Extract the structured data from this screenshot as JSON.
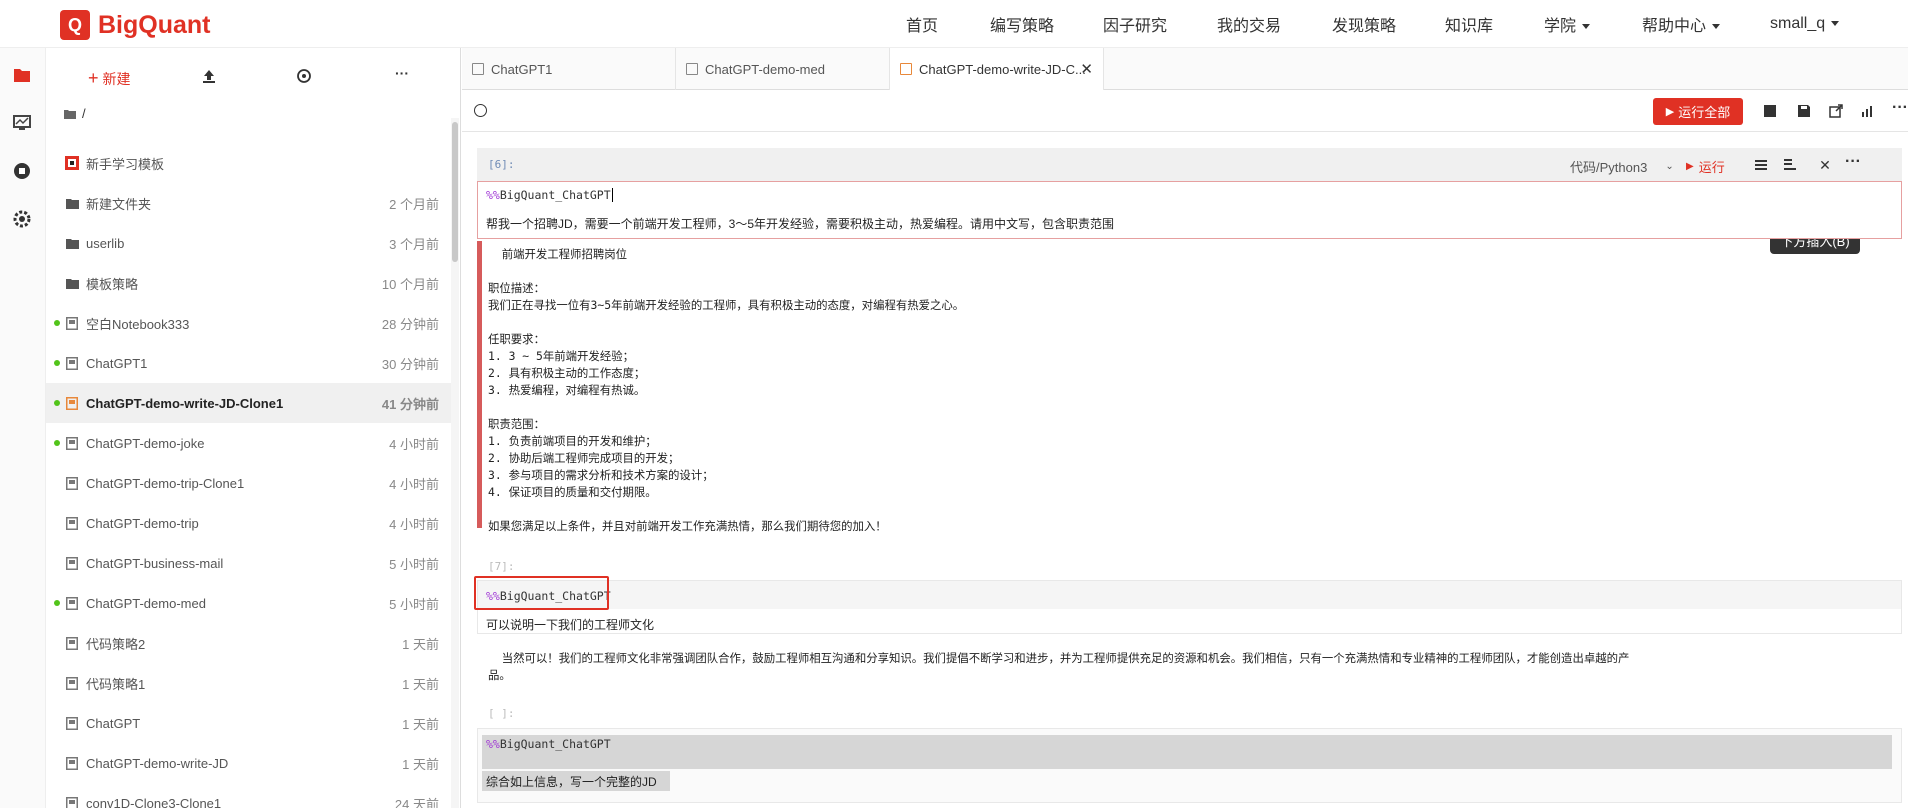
{
  "brand": {
    "name": "BigQuant",
    "mark": "Q"
  },
  "nav": {
    "items": [
      "首页",
      "编写策略",
      "因子研究",
      "我的交易",
      "发现策略",
      "知识库",
      "学院",
      "帮助中心",
      "small_q"
    ]
  },
  "leftbar": {
    "icons": [
      "folder-icon",
      "monitor-icon",
      "stop-icon",
      "settings-icon"
    ]
  },
  "sidebar": {
    "new_label": "新建",
    "path": "/",
    "items": [
      {
        "name": "新手学习模板",
        "time": "",
        "type": "template",
        "running": false
      },
      {
        "name": "新建文件夹",
        "time": "2 个月前",
        "type": "folder",
        "running": false
      },
      {
        "name": "userlib",
        "time": "3 个月前",
        "type": "folder",
        "running": false
      },
      {
        "name": "模板策略",
        "time": "10 个月前",
        "type": "folder",
        "running": false
      },
      {
        "name": "空白Notebook333",
        "time": "28 分钟前",
        "type": "notebook",
        "running": true
      },
      {
        "name": "ChatGPT1",
        "time": "30 分钟前",
        "type": "notebook",
        "running": true
      },
      {
        "name": "ChatGPT-demo-write-JD-Clone1",
        "time": "41 分钟前",
        "type": "notebook-active",
        "running": true
      },
      {
        "name": "ChatGPT-demo-joke",
        "time": "4 小时前",
        "type": "notebook",
        "running": true
      },
      {
        "name": "ChatGPT-demo-trip-Clone1",
        "time": "4 小时前",
        "type": "notebook",
        "running": false
      },
      {
        "name": "ChatGPT-demo-trip",
        "time": "4 小时前",
        "type": "notebook",
        "running": false
      },
      {
        "name": "ChatGPT-business-mail",
        "time": "5 小时前",
        "type": "notebook",
        "running": false
      },
      {
        "name": "ChatGPT-demo-med",
        "time": "5 小时前",
        "type": "notebook",
        "running": true
      },
      {
        "name": "代码策略2",
        "time": "1 天前",
        "type": "notebook",
        "running": false
      },
      {
        "name": "代码策略1",
        "time": "1 天前",
        "type": "notebook",
        "running": false
      },
      {
        "name": "ChatGPT",
        "time": "1 天前",
        "type": "notebook",
        "running": false
      },
      {
        "name": "ChatGPT-demo-write-JD",
        "time": "1 天前",
        "type": "notebook",
        "running": false
      },
      {
        "name": "conv1D-Clone3-Clone1",
        "time": "24 天前",
        "type": "notebook",
        "running": false
      }
    ]
  },
  "tabs": [
    {
      "label": "ChatGPT1",
      "active": false
    },
    {
      "label": "ChatGPT-demo-med",
      "active": false
    },
    {
      "label": "ChatGPT-demo-write-JD-C...",
      "active": true
    }
  ],
  "toolbar": {
    "run_all": "运行全部"
  },
  "cell6": {
    "prompt": "[6]:",
    "kernel": "代码/Python3",
    "run": "运行",
    "tooltip": "下方插入(B)",
    "magic": "%%",
    "magic_name": "BigQuant_ChatGPT",
    "input_text": "帮我一个招聘JD，需要一个前端开发工程师，3～5年开发经验，需要积极主动，热爱编程。请用中文写，包含职责范围",
    "output_lines": [
      "  前端开发工程师招聘岗位",
      "",
      "职位描述：",
      "我们正在寻找一位有3~5年前端开发经验的工程师，具有积极主动的态度，对编程有热爱之心。",
      "",
      "任职要求：",
      "1. 3 ~ 5年前端开发经验；",
      "2. 具有积极主动的工作态度；",
      "3. 热爱编程，对编程有热诚。",
      "",
      "职责范围：",
      "1. 负责前端项目的开发和维护；",
      "2. 协助后端工程师完成项目的开发；",
      "3. 参与项目的需求分析和技术方案的设计；",
      "4. 保证项目的质量和交付期限。",
      "",
      "如果您满足以上条件，并且对前端开发工作充满热情，那么我们期待您的加入！"
    ]
  },
  "cell7": {
    "prompt": "[7]:",
    "magic": "%%",
    "magic_name": "BigQuant_ChatGPT",
    "input_text": "可以说明一下我们的工程师文化",
    "output_line1": "  当然可以！我们的工程师文化非常强调团队合作，鼓励工程师相互沟通和分享知识。我们提倡不断学习和进步，并为工程师提供充足的资源和机会。我们相信，只有一个充满热情和专业精神的工程师团队，才能创造出卓越的产",
    "output_line2": "品。"
  },
  "cell8": {
    "prompt": "[ ]:",
    "magic": "%%",
    "magic_name": "BigQuant_ChatGPT",
    "input_text": "综合如上信息，写一个完整的JD"
  }
}
